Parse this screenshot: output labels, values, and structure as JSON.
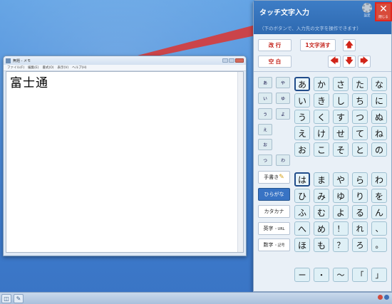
{
  "notepad": {
    "title": "無題 - メモ",
    "menus": [
      "ファイル(F)",
      "編集(E)",
      "書式(O)",
      "表示(V)",
      "ヘルプ(H)"
    ],
    "text": "富士通"
  },
  "panel": {
    "title": "タッチ文字入力",
    "hint": "（下のボタンで、入力先の文字を操作できます）",
    "gear_label": "設定",
    "close_label": "閉じる",
    "line_feed": "改 行",
    "delete_one": "1文字消す",
    "space": "空 白",
    "small_kana": [
      "ぁ",
      "ゃ",
      "ぃ",
      "ゅ",
      "ぅ",
      "ょ",
      "ぇ",
      "ぉ",
      "っ",
      "ゎ"
    ],
    "modes": {
      "handwriting": "手書き",
      "hiragana": "ひらがな",
      "katakana": "カタカナ",
      "alpha": "英字",
      "alpha_sub": "・URL",
      "num": "数字",
      "num_sub": "・記号"
    },
    "kana_rows": [
      [
        "あ",
        "か",
        "さ",
        "た",
        "な"
      ],
      [
        "い",
        "き",
        "し",
        "ち",
        "に"
      ],
      [
        "う",
        "く",
        "す",
        "つ",
        "ぬ"
      ],
      [
        "え",
        "け",
        "せ",
        "て",
        "ね"
      ],
      [
        "お",
        "こ",
        "そ",
        "と",
        "の"
      ],
      [
        "は",
        "ま",
        "や",
        "ら",
        "わ"
      ],
      [
        "ひ",
        "み",
        "ゆ",
        "り",
        "を"
      ],
      [
        "ふ",
        "む",
        "よ",
        "る",
        "ん"
      ],
      [
        "へ",
        "め",
        "！",
        "れ",
        "、"
      ],
      [
        "ほ",
        "も",
        "？",
        "ろ",
        "。"
      ]
    ],
    "symbols": [
      "ー",
      "・",
      "～",
      "「",
      "」"
    ]
  }
}
